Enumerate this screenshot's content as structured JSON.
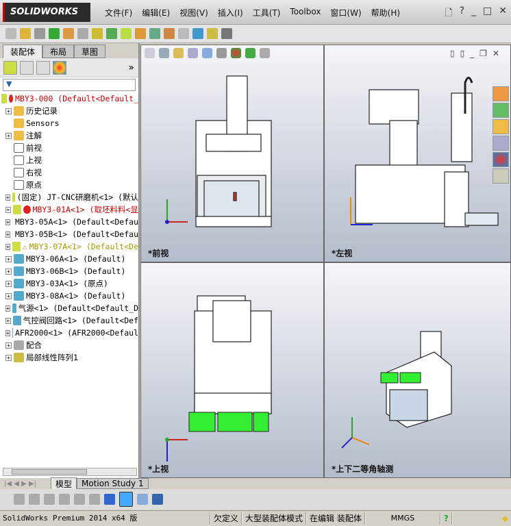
{
  "app": {
    "logo": "SOLIDWORKS"
  },
  "menu": [
    "文件(F)",
    "编辑(E)",
    "视图(V)",
    "插入(I)",
    "工具(T)",
    "Toolbox",
    "窗口(W)",
    "帮助(H)"
  ],
  "panel_tabs": [
    "装配体",
    "布局",
    "草图"
  ],
  "tree": [
    {
      "label": "MBY3-000  (Default<Default_",
      "color": "red",
      "expand": false
    },
    {
      "label": "历史记录",
      "expand": true
    },
    {
      "label": "Sensors",
      "expand": false
    },
    {
      "label": "注解",
      "expand": true
    },
    {
      "label": "前视",
      "expand": false
    },
    {
      "label": "上视",
      "expand": false
    },
    {
      "label": "右视",
      "expand": false
    },
    {
      "label": "原点",
      "expand": false
    },
    {
      "label": "(固定) JT-CNC研磨机<1> (默认",
      "expand": true
    },
    {
      "label": "MBY3-01A<1> (取坯料料<显",
      "color": "red",
      "expand": true
    },
    {
      "label": "MBY3-05A<1> (Default<Defau",
      "expand": true
    },
    {
      "label": "MBY3-05B<1> (Default<Defau",
      "expand": true
    },
    {
      "label": "MBY3-07A<1> (Default<De",
      "color": "yellow",
      "expand": true
    },
    {
      "label": "MBY3-06A<1> (Default)",
      "expand": true
    },
    {
      "label": "MBY3-06B<1> (Default)",
      "expand": true
    },
    {
      "label": "MBY3-03A<1> (原点)",
      "expand": true
    },
    {
      "label": "MBY3-08A<1> (Default)",
      "expand": true
    },
    {
      "label": "气源<1> (Default<Default_D",
      "expand": true
    },
    {
      "label": "气控阀回路<1> (Default<Def",
      "expand": true
    },
    {
      "label": "AFR2000<1> (AFR2000<Defaul",
      "expand": true
    },
    {
      "label": "配合",
      "expand": true
    },
    {
      "label": "局部线性阵列1",
      "expand": true
    }
  ],
  "viewports": [
    "*前视",
    "*左视",
    "*上视",
    "*上下二等角轴测"
  ],
  "bottom_tabs": [
    "模型",
    "Motion Study 1"
  ],
  "status": [
    "SolidWorks Premium 2014 x64 版",
    "欠定义",
    "大型装配体模式",
    "在编辑 装配体",
    "MMGS"
  ]
}
